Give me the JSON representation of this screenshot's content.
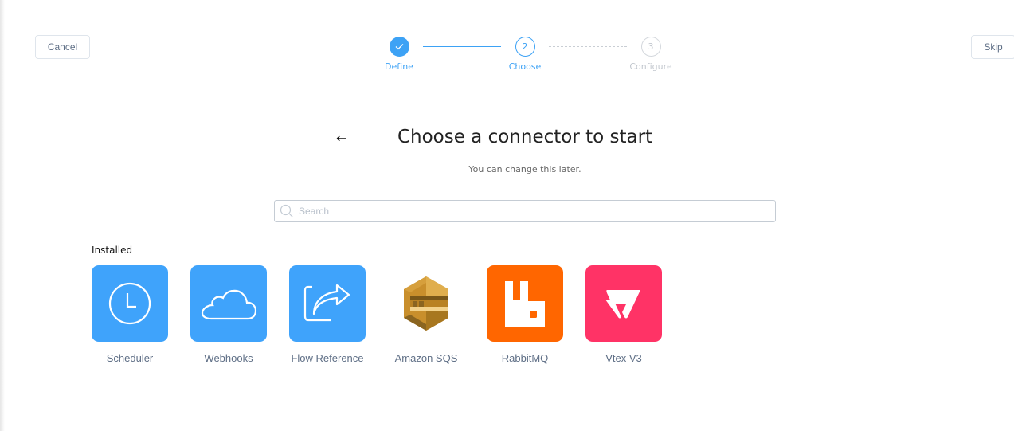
{
  "header": {
    "cancel_label": "Cancel",
    "skip_label": "Skip"
  },
  "stepper": {
    "steps": [
      {
        "number": "1",
        "label": "Define",
        "state": "completed",
        "icon": "check-icon"
      },
      {
        "number": "2",
        "label": "Choose",
        "state": "active"
      },
      {
        "number": "3",
        "label": "Configure",
        "state": "pending"
      }
    ]
  },
  "main": {
    "back_icon": "←",
    "title": "Choose a connector to start",
    "subtitle": "You can change this later.",
    "search": {
      "placeholder": "Search",
      "value": "",
      "icon": "search-icon"
    },
    "section_label": "Installed",
    "connectors": [
      {
        "name": "Scheduler",
        "icon": "clock-icon",
        "color": "#3fa3fb"
      },
      {
        "name": "Webhooks",
        "icon": "cloud-icon",
        "color": "#3fa3fb"
      },
      {
        "name": "Flow Reference",
        "icon": "share-arrow-icon",
        "color": "#3fa3fb"
      },
      {
        "name": "Amazon SQS",
        "icon": "amazon-sqs-logo-icon",
        "color": "#d9a741"
      },
      {
        "name": "RabbitMQ",
        "icon": "rabbitmq-logo-icon",
        "color": "#ff6600"
      },
      {
        "name": "Vtex V3",
        "icon": "vtex-logo-icon",
        "color": "#ff3366"
      }
    ]
  }
}
